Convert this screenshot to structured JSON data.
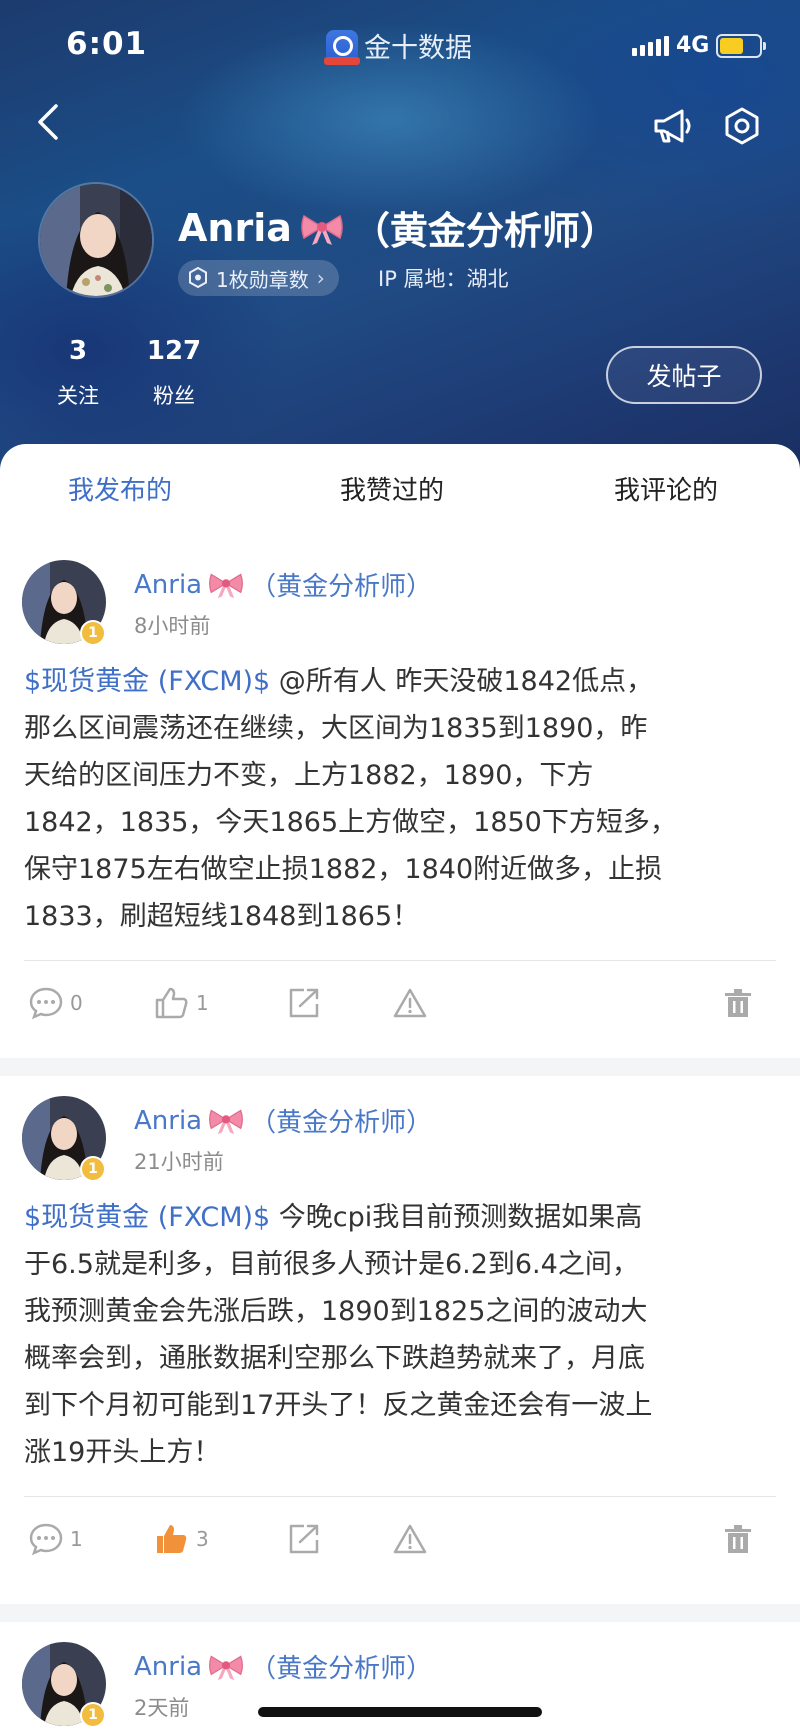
{
  "status_bar": {
    "time": "6:01",
    "app_name": "金十数据",
    "network": "4G",
    "battery_fraction": 0.6
  },
  "header": {
    "back_icon": "chevron-left-icon",
    "announce_icon": "megaphone-icon",
    "settings_icon": "hexagon-settings-icon",
    "name": "Anria",
    "name_suffix": "（黄金分析师）",
    "medal_text": "1枚勋章数",
    "ip_location": "IP 属地：湖北",
    "stats": [
      {
        "value": "3",
        "label": "关注"
      },
      {
        "value": "127",
        "label": "粉丝"
      }
    ],
    "post_button": "发帖子"
  },
  "tabs": [
    {
      "label": "我发布的",
      "active": true
    },
    {
      "label": "我赞过的",
      "active": false
    },
    {
      "label": "我评论的",
      "active": false
    }
  ],
  "posts": [
    {
      "author": "Anria",
      "author_suffix": "（黄金分析师）",
      "level": "1",
      "time": "8小时前",
      "tag": "$现货黄金 (FXCM)$",
      "lines": [
        " @所有人 昨天没破1842低点，",
        "那么区间震荡还在继续，大区间为1835到1890，昨",
        "天给的区间压力不变，上方1882，1890，下方",
        "1842，1835，今天1865上方做空，1850下方短多，",
        "保守1875左右做空止损1882，1840附近做多，止损",
        "1833，刷超短线1848到1865！"
      ],
      "comments": "0",
      "likes": "1",
      "liked": false
    },
    {
      "author": "Anria",
      "author_suffix": "（黄金分析师）",
      "level": "1",
      "time": "21小时前",
      "tag": "$现货黄金 (FXCM)$",
      "lines": [
        " 今晚cpi我目前预测数据如果高",
        "于6.5就是利多，目前很多人预计是6.2到6.4之间，",
        "我预测黄金会先涨后跌，1890到1825之间的波动大",
        "概率会到，通胀数据利空那么下跌趋势就来了，月底",
        "到下个月初可能到17开头了！反之黄金还会有一波上",
        "涨19开头上方！"
      ],
      "comments": "1",
      "likes": "3",
      "liked": true
    },
    {
      "author": "Anria",
      "author_suffix": "（黄金分析师）",
      "level": "1",
      "time": "2天前"
    }
  ]
}
